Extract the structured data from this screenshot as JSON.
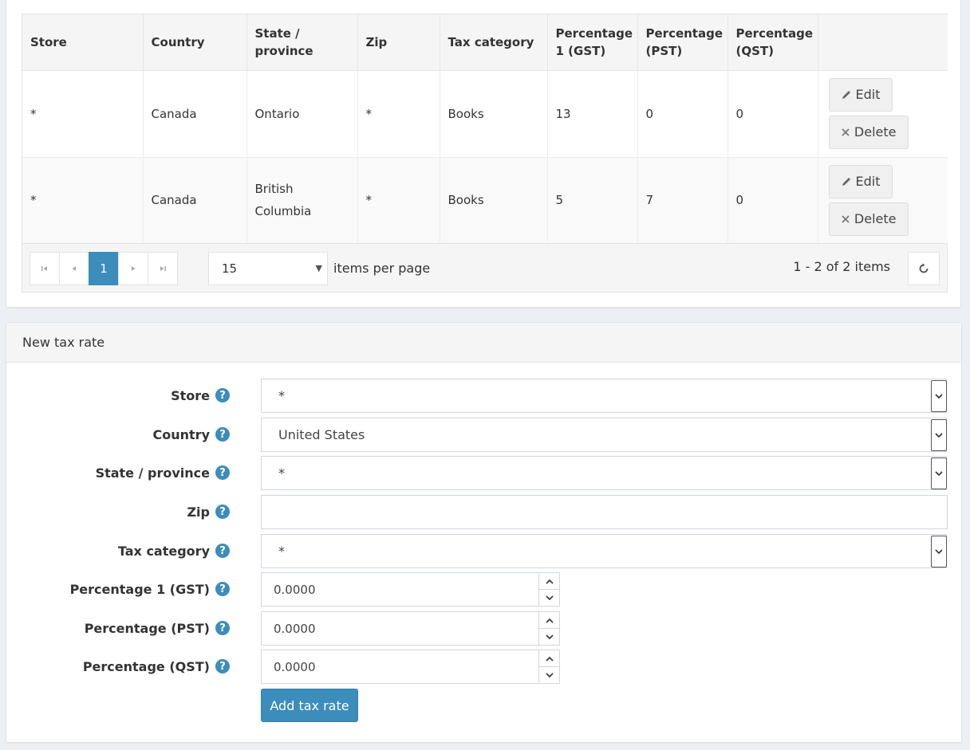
{
  "grid": {
    "columns": [
      "Store",
      "Country",
      "State /\nprovince",
      "Zip",
      "Tax category",
      "Percentage\n1 (GST)",
      "Percentage\n(PST)",
      "Percentage\n(QST)",
      ""
    ],
    "rows": [
      {
        "store": "*",
        "country": "Canada",
        "state": "Ontario",
        "zip": "*",
        "category": "Books",
        "gst": "13",
        "pst": "0",
        "qst": "0"
      },
      {
        "store": "*",
        "country": "Canada",
        "state": "British Columbia",
        "zip": "*",
        "category": "Books",
        "gst": "5",
        "pst": "7",
        "qst": "0"
      }
    ],
    "edit_label": "Edit",
    "delete_label": "Delete",
    "pager": {
      "current_page": "1",
      "page_size": "15",
      "items_per_page_label": "items per page",
      "info": "1 - 2 of 2 items"
    }
  },
  "form": {
    "title": "New tax rate",
    "store": {
      "label": "Store",
      "value": "*"
    },
    "country": {
      "label": "Country",
      "value": "United States"
    },
    "state": {
      "label": "State / province",
      "value": "*"
    },
    "zip": {
      "label": "Zip",
      "value": ""
    },
    "tax_category": {
      "label": "Tax category",
      "value": "*"
    },
    "gst": {
      "label": "Percentage 1 (GST)",
      "value": "0.0000"
    },
    "pst": {
      "label": "Percentage (PST)",
      "value": "0.0000"
    },
    "qst": {
      "label": "Percentage (QST)",
      "value": "0.0000"
    },
    "help_glyph": "?",
    "submit_label": "Add tax rate"
  },
  "colors": {
    "accent": "#3c8dbc",
    "background": "#ecf0f5"
  }
}
